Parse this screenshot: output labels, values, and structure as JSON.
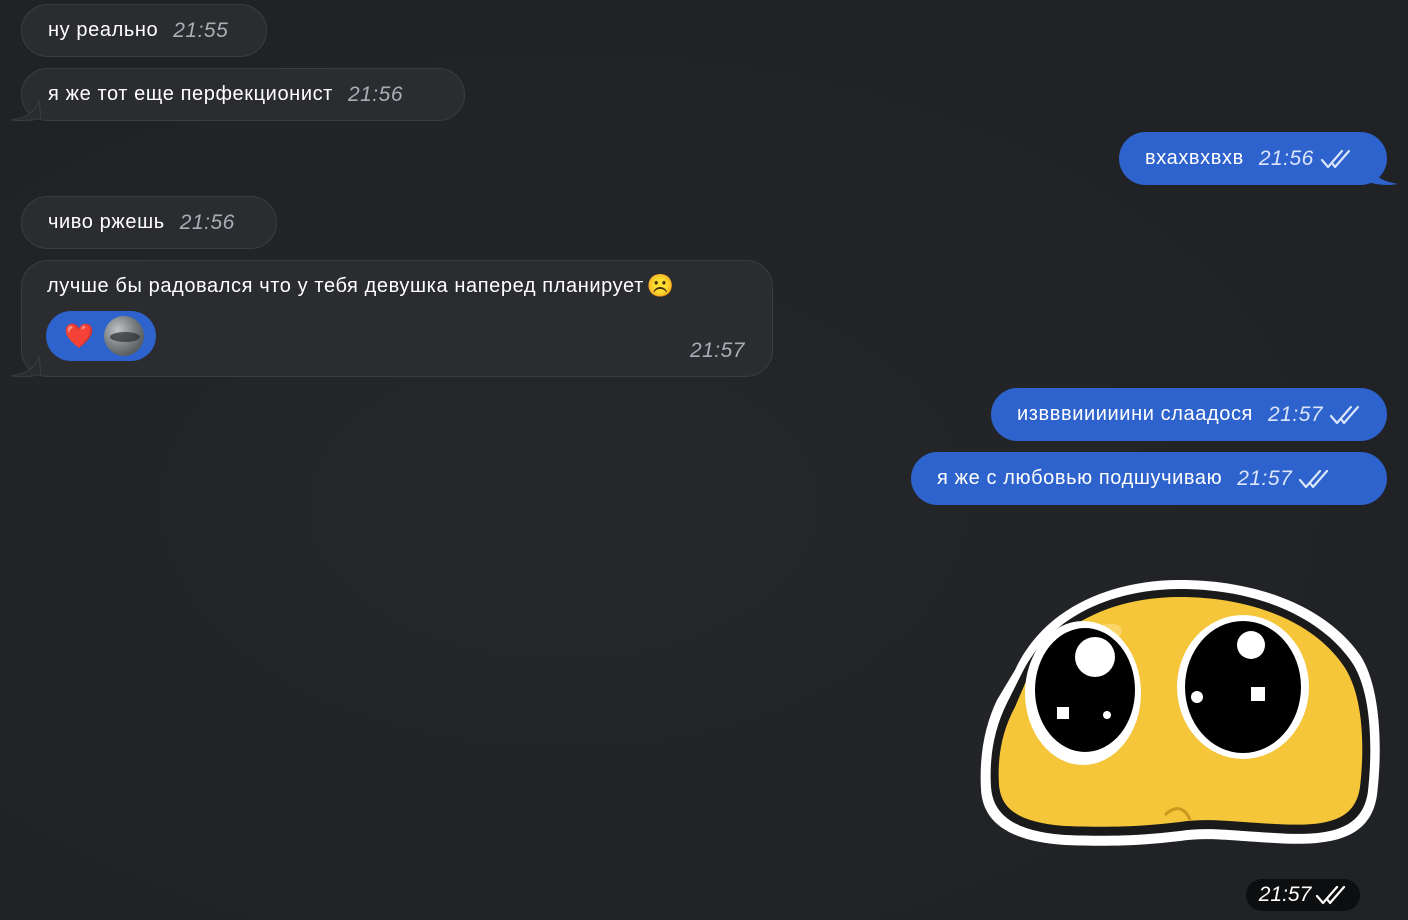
{
  "messages": [
    {
      "text": "ну реально",
      "time": "21:55"
    },
    {
      "text": "я же тот еще перфекционист",
      "time": "21:56"
    },
    {
      "text": "вхахвхвхв",
      "time": "21:56"
    },
    {
      "text": "чиво ржешь",
      "time": "21:56"
    },
    {
      "text": "лучше бы радовался что у тебя девушка наперед планирует",
      "emoji": "☹️",
      "time": "21:57"
    },
    {
      "text": "извввииииини слаадося",
      "time": "21:57"
    },
    {
      "text": "я же с любовью подшучиваю",
      "time": "21:57"
    }
  ],
  "reaction": {
    "emoji": "❤️"
  },
  "sticker": {
    "time": "21:57"
  },
  "colors": {
    "background": "#212327",
    "incoming_bubble": "#2a2c30",
    "outgoing_bubble": "#2e62cc",
    "sticker_yellow": "#f5c53a"
  },
  "icons": {
    "read_receipt": "double-check-icon",
    "sticker": "pleading-face-sticker"
  }
}
